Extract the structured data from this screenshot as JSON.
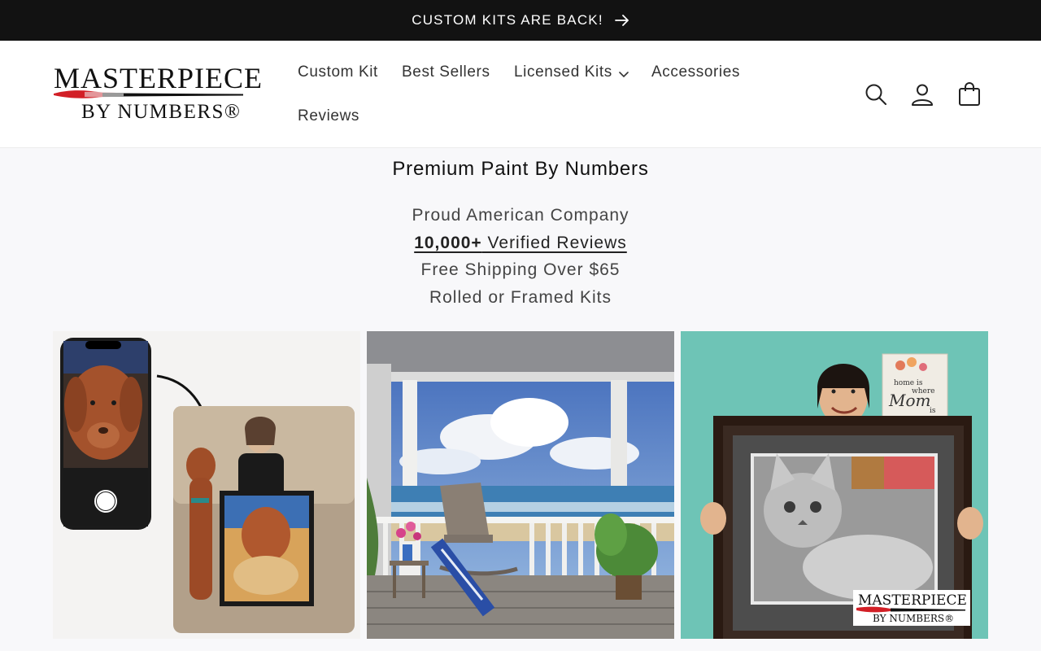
{
  "announcement": {
    "text": "CUSTOM KITS ARE BACK!",
    "icon": "arrow-right-icon"
  },
  "logo": {
    "line1": "MASTERPIECE",
    "line2": "BY NUMBERS®"
  },
  "nav": {
    "items": [
      {
        "label": "Custom Kit"
      },
      {
        "label": "Best Sellers"
      },
      {
        "label": "Licensed Kits",
        "icon": "chevron-down-icon"
      },
      {
        "label": "Accessories"
      },
      {
        "label": "Reviews"
      }
    ]
  },
  "header_icons": [
    "search-icon",
    "account-icon",
    "cart-icon"
  ],
  "hero": {
    "title": "Premium Paint By Numbers",
    "lines": {
      "company": "Proud American Company",
      "reviews_count": "10,000+",
      "reviews_label": " Verified Reviews",
      "shipping": "Free Shipping Over $65",
      "kits": "Rolled or Framed Kits"
    }
  },
  "tiles": [
    {
      "name": "custom-kit-dog-photo"
    },
    {
      "name": "beach-porch-painting"
    },
    {
      "name": "framed-cat-painting",
      "watermark_line1": "MASTERPIECE",
      "watermark_line2": "BY NUMBERS®",
      "sign_text": "home is where Mom is"
    }
  ],
  "colors": {
    "announcement_bg": "#121212",
    "page_bg": "#f8f8fa",
    "accent_red": "#d21f26"
  }
}
